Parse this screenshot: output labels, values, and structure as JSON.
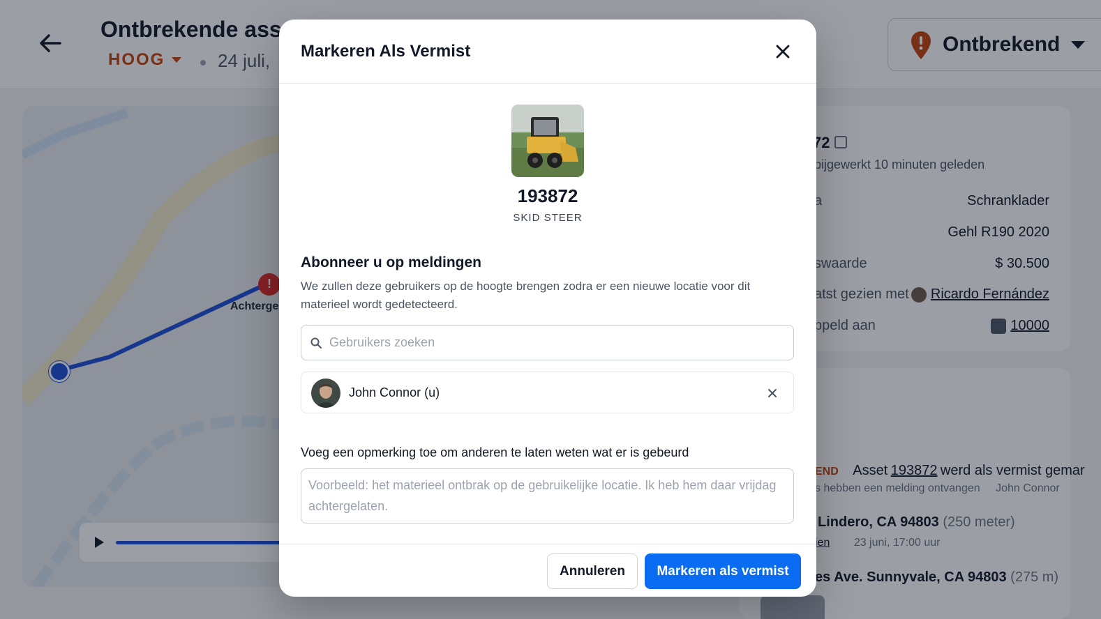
{
  "background": {
    "title": "Ontbrekende ass",
    "priority": "HOOG",
    "date": "24 juli,",
    "status": {
      "label": "Ontbrekend",
      "icon": "location-pin-alert-icon",
      "color": "#c2410c"
    },
    "map": {
      "label": "Achterge"
    },
    "details": {
      "asset_no": "72",
      "updated": "bijgewerkt 10 minuten geleden",
      "rows": [
        {
          "label": "a",
          "value": "Schranklader"
        },
        {
          "label": "",
          "value": "Gehl R190 2020"
        },
        {
          "label": "swaarde",
          "value": "$ 30.500"
        },
        {
          "label": "atst gezien met",
          "value": "Ricardo Fernández"
        },
        {
          "label": "ppeld aan",
          "value": "10000"
        }
      ]
    },
    "event": {
      "badge": "END",
      "prefix": "Asset",
      "asset_link": "193872",
      "suffix": "werd als vermist gemar",
      "sub": "s hebben een melding ontvangen",
      "sub_user": "John Connor"
    },
    "locations": [
      {
        "address": "Lindero, CA 94803",
        "distance": "(250 meter)",
        "meta_link": "ien",
        "meta_date": "23 juni, 17:00 uur"
      },
      {
        "address": "es Ave. Sunnyvale, CA 94803",
        "distance": "(275 m)"
      }
    ]
  },
  "modal": {
    "title": "Markeren Als Vermist",
    "asset": {
      "id": "193872",
      "type": "SKID STEER"
    },
    "subscribe": {
      "title": "Abonneer u op meldingen",
      "description": "We zullen deze gebruikers op de hoogte brengen zodra er een nieuwe locatie voor dit materieel wordt gedetecteerd.",
      "search_placeholder": "Gebruikers zoeken",
      "search_value": ""
    },
    "users": [
      {
        "name": "John Connor (u)"
      }
    ],
    "comment": {
      "label": "Voeg een opmerking toe om anderen te laten weten wat er is gebeurd",
      "placeholder": "Voorbeeld: het materieel ontbrak op de gebruikelijke locatie. Ik heb hem daar vrijdag achtergelaten.",
      "value": ""
    },
    "buttons": {
      "cancel": "Annuleren",
      "confirm": "Markeren als vermist"
    },
    "colors": {
      "primary": "#0a6cf0",
      "priority": "#c2410c"
    }
  }
}
